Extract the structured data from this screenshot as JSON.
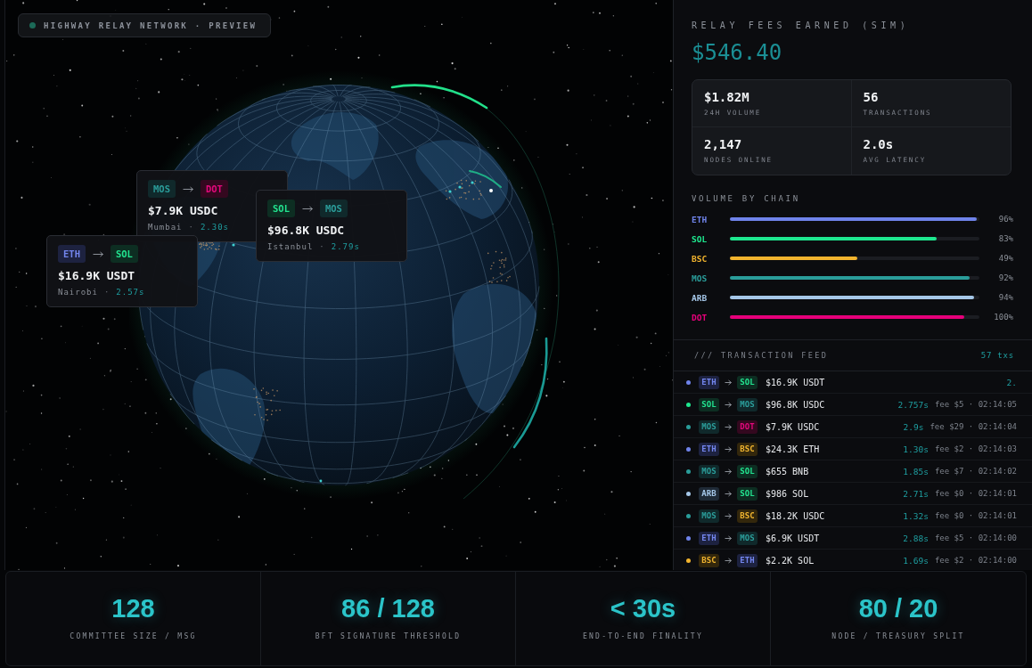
{
  "header": {
    "title": "HIGHWAY RELAY NETWORK · PREVIEW"
  },
  "route_cards": [
    {
      "from": {
        "label": "MOS",
        "kind": "mos"
      },
      "to": {
        "label": "DOT",
        "kind": "dot"
      },
      "amount": "$7.9K USDC",
      "city": "Mumbai",
      "separator": "·",
      "time": "2.30s"
    },
    {
      "from": {
        "label": "SOL",
        "kind": "sol"
      },
      "to": {
        "label": "MOS",
        "kind": "mos"
      },
      "amount": "$96.8K USDC",
      "city": "Istanbul",
      "separator": "·",
      "time": "2.79s"
    },
    {
      "from": {
        "label": "ETH",
        "kind": "eth"
      },
      "to": {
        "label": "SOL",
        "kind": "sol"
      },
      "amount": "$16.9K USDT",
      "city": "Nairobi",
      "separator": "·",
      "time": "2.57s"
    }
  ],
  "side_panel": {
    "fees": {
      "label": "RELAY FEES EARNED (SIM)",
      "value": "$546.40"
    },
    "stats": [
      {
        "value": "$1.82M",
        "label": "24H VOLUME"
      },
      {
        "value": "56",
        "label": "TRANSACTIONS"
      },
      {
        "value": "2,147",
        "label": "NODES ONLINE"
      },
      {
        "value": "2.0s",
        "label": "AVG LATENCY"
      }
    ],
    "volume_by_chain": {
      "title": "VOLUME BY CHAIN",
      "chains": [
        {
          "label": "ETH",
          "color": "#6f83ea",
          "level": 0.99,
          "percent": "96%"
        },
        {
          "label": "SOL",
          "color": "#1ee88f",
          "level": 0.83,
          "percent": "83%"
        },
        {
          "label": "BSC",
          "color": "#f2b42e",
          "level": 0.51,
          "percent": "49%"
        },
        {
          "label": "MOS",
          "color": "#2a9d9a",
          "level": 0.96,
          "percent": "92%"
        },
        {
          "label": "ARB",
          "color": "#a5c7e8",
          "level": 0.98,
          "percent": "94%"
        },
        {
          "label": "DOT",
          "color": "#e6007a",
          "level": 0.94,
          "percent": "100%"
        }
      ]
    },
    "feed": {
      "title": "/// TRANSACTION FEED",
      "count": "57 txs",
      "rows": [
        {
          "color": "#6f83ea",
          "from": {
            "label": "ETH",
            "kind": "eth"
          },
          "to": {
            "label": "SOL",
            "kind": "sol"
          },
          "amount": "$16.9K USDT",
          "time": "2."
        },
        {
          "color": "#1ee88f",
          "from": {
            "label": "SOL",
            "kind": "sol"
          },
          "to": {
            "label": "MOS",
            "kind": "mos"
          },
          "amount": "$96.8K USDC",
          "time": "2.757s",
          "fee": "fee $5 · 02:14:05"
        },
        {
          "color": "#2a9d9a",
          "from": {
            "label": "MOS",
            "kind": "mos"
          },
          "to": {
            "label": "DOT",
            "kind": "dot"
          },
          "amount": "$7.9K USDC",
          "time": "2.9s",
          "fee": "fee $29 · 02:14:04"
        },
        {
          "color": "#6f83ea",
          "from": {
            "label": "ETH",
            "kind": "eth"
          },
          "to": {
            "label": "BSC",
            "kind": "bsc"
          },
          "amount": "$24.3K ETH",
          "time": "1.30s",
          "fee": "fee $2 · 02:14:03"
        },
        {
          "color": "#2a9d9a",
          "from": {
            "label": "MOS",
            "kind": "mos"
          },
          "to": {
            "label": "SOL",
            "kind": "sol"
          },
          "amount": "$655 BNB",
          "time": "1.85s",
          "fee": "fee $7 · 02:14:02"
        },
        {
          "color": "#a5c7e8",
          "from": {
            "label": "ARB",
            "kind": "arb"
          },
          "to": {
            "label": "SOL",
            "kind": "sol"
          },
          "amount": "$986 SOL",
          "time": "2.71s",
          "fee": "fee $0 · 02:14:01"
        },
        {
          "color": "#2a9d9a",
          "from": {
            "label": "MOS",
            "kind": "mos"
          },
          "to": {
            "label": "BSC",
            "kind": "bsc"
          },
          "amount": "$18.2K USDC",
          "time": "1.32s",
          "fee": "fee $0 · 02:14:01"
        },
        {
          "color": "#6f83ea",
          "from": {
            "label": "ETH",
            "kind": "eth"
          },
          "to": {
            "label": "MOS",
            "kind": "mos"
          },
          "amount": "$6.9K USDT",
          "time": "2.88s",
          "fee": "fee $5 · 02:14:00"
        },
        {
          "color": "#f2b42e",
          "from": {
            "label": "BSC",
            "kind": "bsc"
          },
          "to": {
            "label": "ETH",
            "kind": "eth"
          },
          "amount": "$2.2K SOL",
          "time": "1.69s",
          "fee": "fee $2 · 02:14:00"
        }
      ]
    }
  },
  "footer_stats": [
    {
      "value": "128",
      "label": "COMMITTEE SIZE / MSG"
    },
    {
      "value": "86 / 128",
      "label": "BFT SIGNATURE THRESHOLD"
    },
    {
      "value": "< 30s",
      "label": "END-TO-END FINALITY"
    },
    {
      "value": "80 / 20",
      "label": "NODE / TREASURY SPLIT"
    }
  ]
}
